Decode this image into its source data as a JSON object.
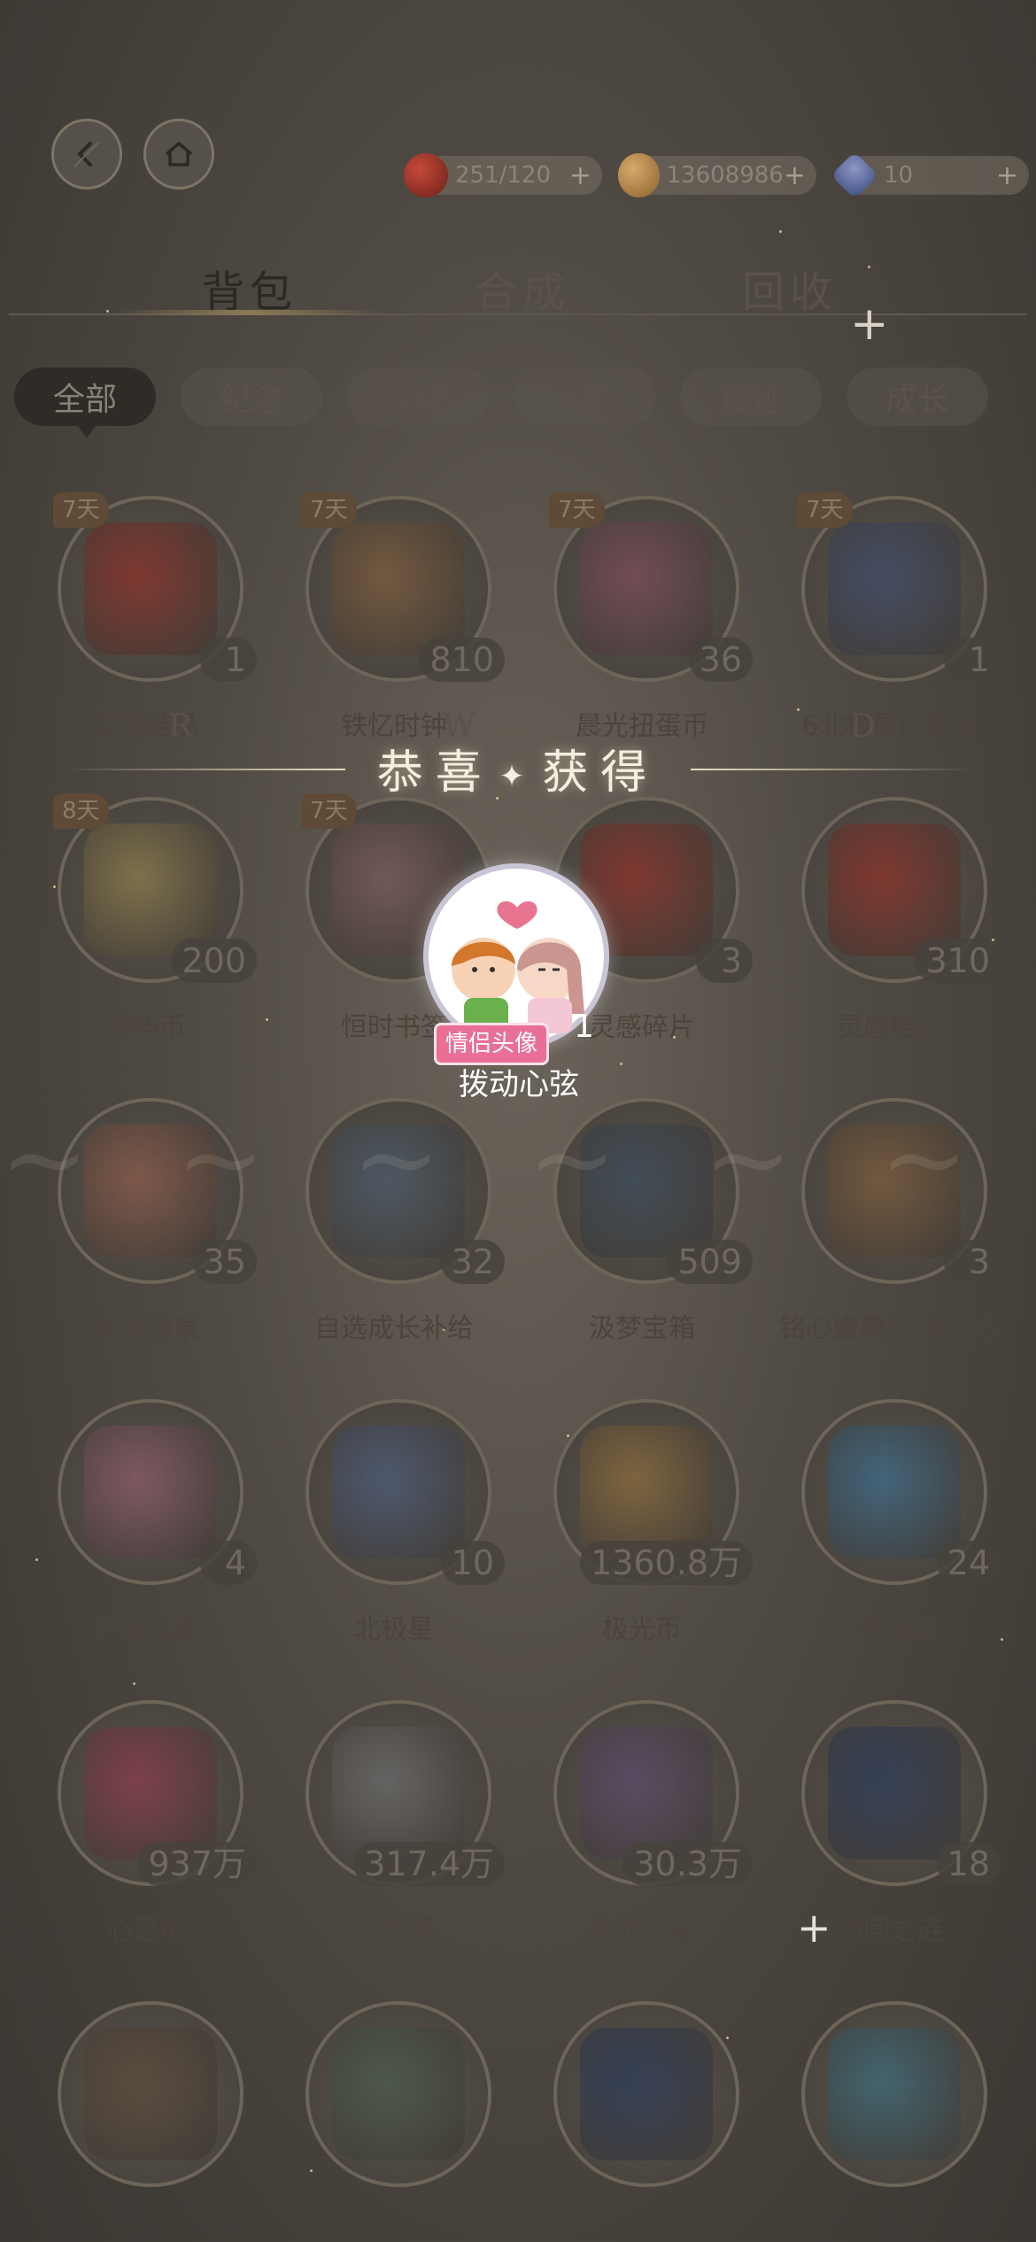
{
  "topbar": {
    "resources": [
      {
        "icon": "apple-icon",
        "value": "251/120",
        "plus": "+"
      },
      {
        "icon": "coin-icon",
        "value": "13608986",
        "plus": "+"
      },
      {
        "icon": "gem-icon",
        "value": "10",
        "plus": "+"
      }
    ]
  },
  "main_tabs": [
    "背包",
    "合成",
    "回收"
  ],
  "filters": [
    "全部",
    "纪念",
    "突破",
    "光影",
    "铭迹",
    "成长"
  ],
  "items": [
    {
      "name": "灵感结晶",
      "count": "1",
      "badge": "7天",
      "color": "#8a2f26"
    },
    {
      "name": "铁忆时钟",
      "count": "810",
      "badge": "7天",
      "color": "#7b5a3a"
    },
    {
      "name": "晨光扭蛋币",
      "count": "36",
      "badge": "7天",
      "color": "#7a4a5a"
    },
    {
      "name": "6北极星优惠券",
      "count": "1",
      "badge": "7天",
      "color": "#3d4a6a"
    },
    {
      "name": "梦屿币",
      "count": "200",
      "badge": "8天",
      "color": "#8a7a4a"
    },
    {
      "name": "恒时书签",
      "count": "",
      "badge": "7天",
      "color": "#7a5a5a"
    },
    {
      "name": "灵感碎片",
      "count": "3",
      "badge": "",
      "color": "#8a2f26"
    },
    {
      "name": "灵感结晶",
      "count": "310",
      "badge": "",
      "color": "#8a2f26"
    },
    {
      "name": "灵感源泉",
      "count": "35",
      "badge": "",
      "color": "#8a5a4a"
    },
    {
      "name": "自选成长补给",
      "count": "32",
      "badge": "",
      "color": "#4a5a6a"
    },
    {
      "name": "汲梦宝箱",
      "count": "509",
      "badge": "",
      "color": "#3a4a5a"
    },
    {
      "name": "铭心盛典·忆旅自选",
      "count": "3",
      "badge": "",
      "color": "#7a5a3a"
    },
    {
      "name": "芳菲礼盒",
      "count": "4",
      "badge": "",
      "color": "#8a5a6a"
    },
    {
      "name": "北极星",
      "count": "10",
      "badge": "",
      "color": "#4a5a7a"
    },
    {
      "name": "极光币",
      "count": "1360.8万",
      "badge": "",
      "color": "#8a6a3a"
    },
    {
      "name": "小熊星座",
      "count": "24",
      "badge": "",
      "color": "#3a6a8a"
    },
    {
      "name": "心愿币",
      "count": "937万",
      "badge": "",
      "color": "#8a3a4a"
    },
    {
      "name": "绮光币",
      "count": "317.4万",
      "badge": "",
      "color": "#6a6a6a"
    },
    {
      "name": "拾光之星",
      "count": "30.3万",
      "badge": "",
      "color": "#5a4a6a"
    },
    {
      "name": "溯回之涟",
      "count": "18",
      "badge": "",
      "color": "#2a3a5a"
    },
    {
      "name": "",
      "count": "",
      "badge": "",
      "color": "#5a4a3a"
    },
    {
      "name": "",
      "count": "",
      "badge": "",
      "color": "#4a5a4a"
    },
    {
      "name": "",
      "count": "",
      "badge": "",
      "color": "#2a3a5a"
    },
    {
      "name": "",
      "count": "",
      "badge": "",
      "color": "#3a6a7a"
    }
  ],
  "reward": {
    "title_left": "恭喜",
    "title_star": "✦",
    "title_right": "获得",
    "letters": [
      "R",
      "E",
      "W",
      "A",
      "R",
      "D"
    ],
    "item_tag": "情侣头像",
    "item_count": "1",
    "item_name": "拨动心弦"
  },
  "colors": {
    "overlay_bg": "#4f4a43",
    "reward_tag": "#e96f96",
    "badge": "#5e4a37"
  }
}
